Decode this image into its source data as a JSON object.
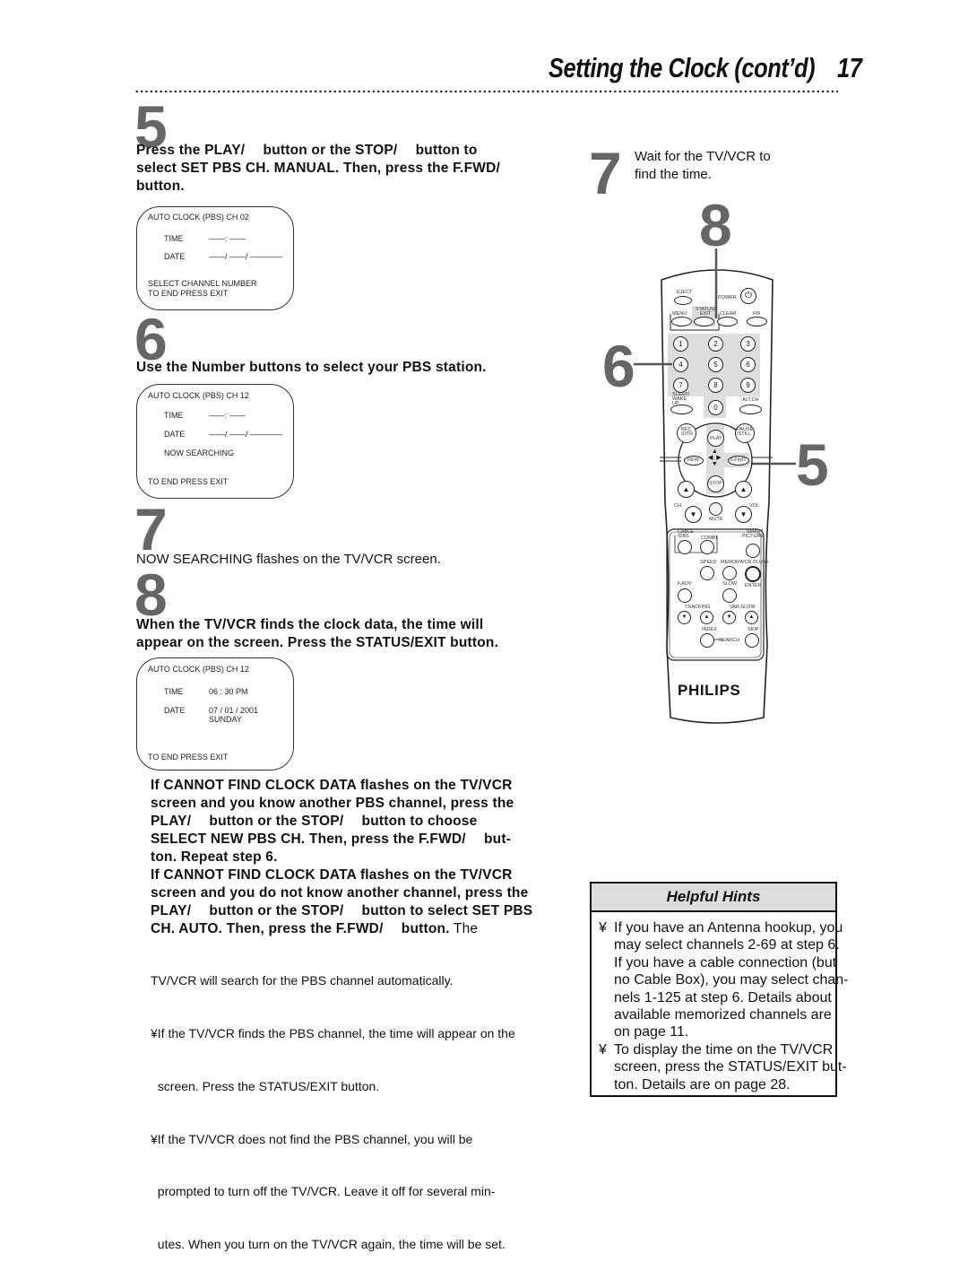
{
  "header": {
    "title": "Setting the Clock (cont’d)",
    "page_number": "17"
  },
  "step5": {
    "number": "5",
    "lines": [
      "Press the PLAY/  button or the STOP/  button to",
      "select SET PBS CH. MANUAL. Then, press the F.FWD/",
      "button."
    ],
    "osd": {
      "title": "AUTO CLOCK (PBS) CH 02",
      "time_label": "TIME",
      "time_value": "——: ——",
      "date_label": "DATE",
      "date_value": "——/ ——/ ————",
      "line1": "SELECT CHANNEL NUMBER",
      "line2": "TO END PRESS EXIT"
    }
  },
  "step6": {
    "number": "6",
    "text": "Use the Number buttons to select your PBS station.",
    "osd": {
      "title": "AUTO CLOCK (PBS) CH 12",
      "time_label": "TIME",
      "time_value": "——: ——",
      "date_label": "DATE",
      "date_value": "——/ ——/ ————",
      "status": "NOW SEARCHING",
      "footer": "TO END PRESS EXIT"
    }
  },
  "step7": {
    "number": "7",
    "text": "NOW SEARCHING flashes on the TV/VCR screen.",
    "side_lines": [
      "Wait for the TV/VCR to",
      "find the time."
    ]
  },
  "step8": {
    "number": "8",
    "lines": [
      "When the TV/VCR finds the clock data, the time will",
      "appear on the screen. Press the STATUS/EXIT button."
    ],
    "osd": {
      "title": "AUTO CLOCK (PBS) CH 12",
      "time_label": "TIME",
      "time_value": "06 : 30 PM",
      "date_label": "DATE",
      "date_value": "07 / 01 / 2001",
      "day_value": "SUNDAY",
      "footer": "TO END PRESS EXIT"
    }
  },
  "notes": {
    "bold_lines": [
      "If CANNOT FIND CLOCK DATA flashes on the TV/VCR",
      "screen and you know another PBS channel, press the",
      "PLAY/  button or the STOP/  button to choose",
      "SELECT NEW PBS CH. Then, press the F.FWD/  but-",
      "ton. Repeat step 6.",
      "If CANNOT FIND CLOCK DATA flashes on the TV/VCR",
      "screen and you do not know another channel, press the",
      "PLAY/  button or the STOP/  button to select SET PBS"
    ],
    "mixed_line_bold": "CH. AUTO. Then, press the F.FWD/  button.",
    "mixed_line_plain": " The",
    "plain_lines": [
      "TV/VCR will search for the PBS channel automatically.",
      "¥If the TV/VCR finds the PBS channel, the time will appear on the",
      "  screen. Press the STATUS/EXIT button.",
      "¥If the TV/VCR does not find the PBS channel, you will be",
      "  prompted to turn off the TV/VCR. Leave it off for several min-",
      "  utes. When you turn on the TV/VCR again, the time will be set."
    ]
  },
  "hints": {
    "title": "Helpful Hints",
    "items": [
      {
        "bullet": "¥",
        "lines": [
          "If you have an Antenna hookup, you",
          "may select channels 2-69 at step 6.",
          "If you have a cable connection (but",
          "no Cable Box), you may select chan-",
          "nels 1-125 at step 6. Details about",
          "available memorized channels are",
          "on page 11."
        ]
      },
      {
        "bullet": "¥",
        "lines": [
          "To display the time on the TV/VCR",
          "screen, press the STATUS/EXIT but-",
          "ton. Details are on page 28."
        ]
      }
    ]
  },
  "remote": {
    "callouts": [
      "8",
      "6",
      "5"
    ],
    "brand": "PHILIPS",
    "labels": {
      "eject": "EJECT",
      "power": "POWER",
      "menu": "MENU",
      "status_exit": "STATUS/ EXIT",
      "clear": "CLEAR",
      "fm": "FM",
      "sleep": "SLEEP/ WAKE UP",
      "alt_ch": "ALT.CH",
      "rec": "REC /OTR",
      "pause": "PAUSE /STILL",
      "play": "PLAY",
      "rew": "REW",
      "ffwd": "F.FWD",
      "stop": "STOP",
      "ch": "CH.",
      "vol": "VOL.",
      "mute": "MUTE",
      "cable": "CABLE /DBS",
      "combi": "COMBI",
      "smart": "SMART PICTURE",
      "speed": "SPEED",
      "memory": "MEMORY",
      "vcrplus": "VCR PLUS+",
      "enter": "ENTER",
      "fadv": "F.ADV",
      "slow": "SLOW",
      "tracking": "TRACKING",
      "varslow": "VAR.SLOW",
      "index": "INDEX",
      "skip": "SKIP",
      "search": "SEARCH"
    },
    "digits": [
      "1",
      "2",
      "3",
      "4",
      "5",
      "6",
      "7",
      "8",
      "9",
      "0"
    ]
  }
}
